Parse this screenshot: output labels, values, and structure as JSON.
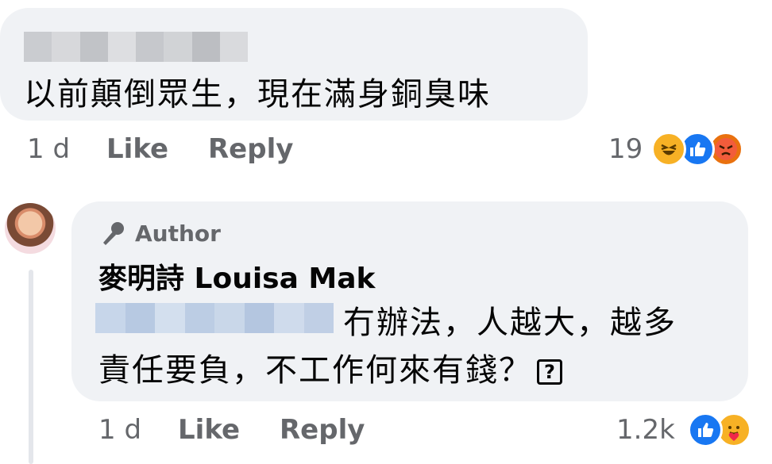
{
  "comment1": {
    "text": "以前顛倒眾生，現在滿身銅臭味",
    "time": "1 d",
    "like_label": "Like",
    "reply_label": "Reply",
    "reaction_count": "19",
    "reactions": [
      "haha-icon",
      "like-icon",
      "angry-icon"
    ]
  },
  "comment2": {
    "author_badge": "Author",
    "author_name": "麥明詩 Louisa Mak",
    "line1": "冇辦法，人越大，越多",
    "line2": "責任要負，不工作何來有錢？",
    "question_box": "?",
    "time": "1 d",
    "like_label": "Like",
    "reply_label": "Reply",
    "reaction_count": "1.2k",
    "reactions": [
      "like-icon",
      "care-icon"
    ]
  },
  "colors": {
    "bubble": "#f0f2f5",
    "meta_text": "#65676b",
    "like_blue": "#1877f2",
    "haha_yellow": "#f7b125",
    "angry_orange": "#e9710f"
  }
}
